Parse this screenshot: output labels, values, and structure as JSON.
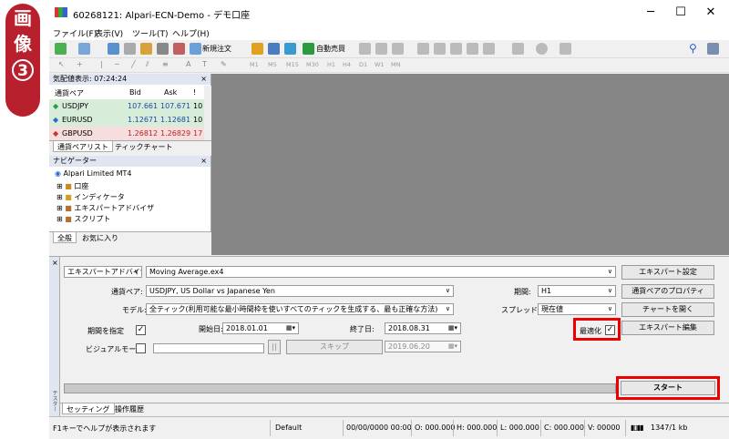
{
  "badge": {
    "l1": "画",
    "l2": "像",
    "num": "3"
  },
  "window": {
    "title": "60268121: Alpari-ECN-Demo - デモ口座",
    "minimize": "─",
    "maximize": "☐",
    "close": "✕"
  },
  "menu": [
    "ファイル(F)",
    "表示(V)",
    "ツール(T)",
    "ヘルプ(H)"
  ],
  "toolbar": {
    "new_order": "新規注文",
    "auto_trade": "自動売買"
  },
  "timeframes": [
    "M1",
    "M5",
    "M15",
    "M30",
    "H1",
    "H4",
    "D1",
    "W1",
    "MN"
  ],
  "market_watch": {
    "header": "気配値表示: 07:24:24",
    "close": "×",
    "col_symbol": "通貨ペア",
    "col_bid": "Bid",
    "col_ask": "Ask",
    "col_extra": "!",
    "rows": [
      {
        "symbol": "USDJPY",
        "bid": "107.661",
        "ask": "107.671",
        "spread": "10",
        "color": "#2a9a4a"
      },
      {
        "symbol": "EURUSD",
        "bid": "1.12671",
        "ask": "1.12681",
        "spread": "10",
        "color": "#2a6ad0"
      },
      {
        "symbol": "GBPUSD",
        "bid": "1.26812",
        "ask": "1.26829",
        "spread": "17",
        "color": "#d03030"
      }
    ],
    "tab_symbols": "通貨ペアリスト",
    "tab_ticks": "ティックチャート"
  },
  "navigator": {
    "header": "ナビゲーター",
    "close": "×",
    "root": "Alpari Limited MT4",
    "items": [
      "口座",
      "インディケータ",
      "エキスパートアドバイザ",
      "スクリプト"
    ],
    "tab_common": "全般",
    "tab_fav": "お気に入り"
  },
  "tester": {
    "close": "×",
    "side_label": "テスター",
    "type": "エキスパートアドバイザ",
    "ea_file": "Moving Average.ex4",
    "symbol_label": "通貨ペア:",
    "symbol_value": "USDJPY, US Dollar vs Japanese Yen",
    "model_label": "モデル:",
    "model_value": "全ティック(利用可能な最小時間枠を使いすべてのティックを生成する、最も正確な方法)",
    "period_label": "期間:",
    "period_value": "H1",
    "spread_label": "スプレッド:",
    "spread_value": "現在値",
    "use_date_label": "期間を指定",
    "from_label": "開始日:",
    "from_value": "2018.01.01",
    "to_label": "終了日:",
    "to_value": "2018.08.31",
    "optimization_label": "最適化",
    "visual_label": "ビジュアルモード",
    "skip_label": "スキップ",
    "skip_date": "2019.06.20",
    "pause": "||",
    "btn_ea_props": "エキスパート設定",
    "btn_symbol_props": "通貨ペアのプロパティ",
    "btn_open_chart": "チャートを開く",
    "btn_modify_ea": "エキスパート編集",
    "btn_start": "スタート",
    "tab_settings": "セッティング",
    "tab_journal": "操作履歴"
  },
  "status": {
    "help": "F1キーでヘルプが表示されます",
    "profile": "Default",
    "datetime": "00/00/0000 00:00",
    "open": "O: 000.000",
    "high": "H: 000.000",
    "low": "L: 000.000",
    "close": "C: 000.000",
    "volume": "V: 00000",
    "traffic": "1347/1 kb"
  },
  "colors": {
    "badge": "#b8202e",
    "highlight": "#e00000",
    "chart_bg": "#868686"
  }
}
